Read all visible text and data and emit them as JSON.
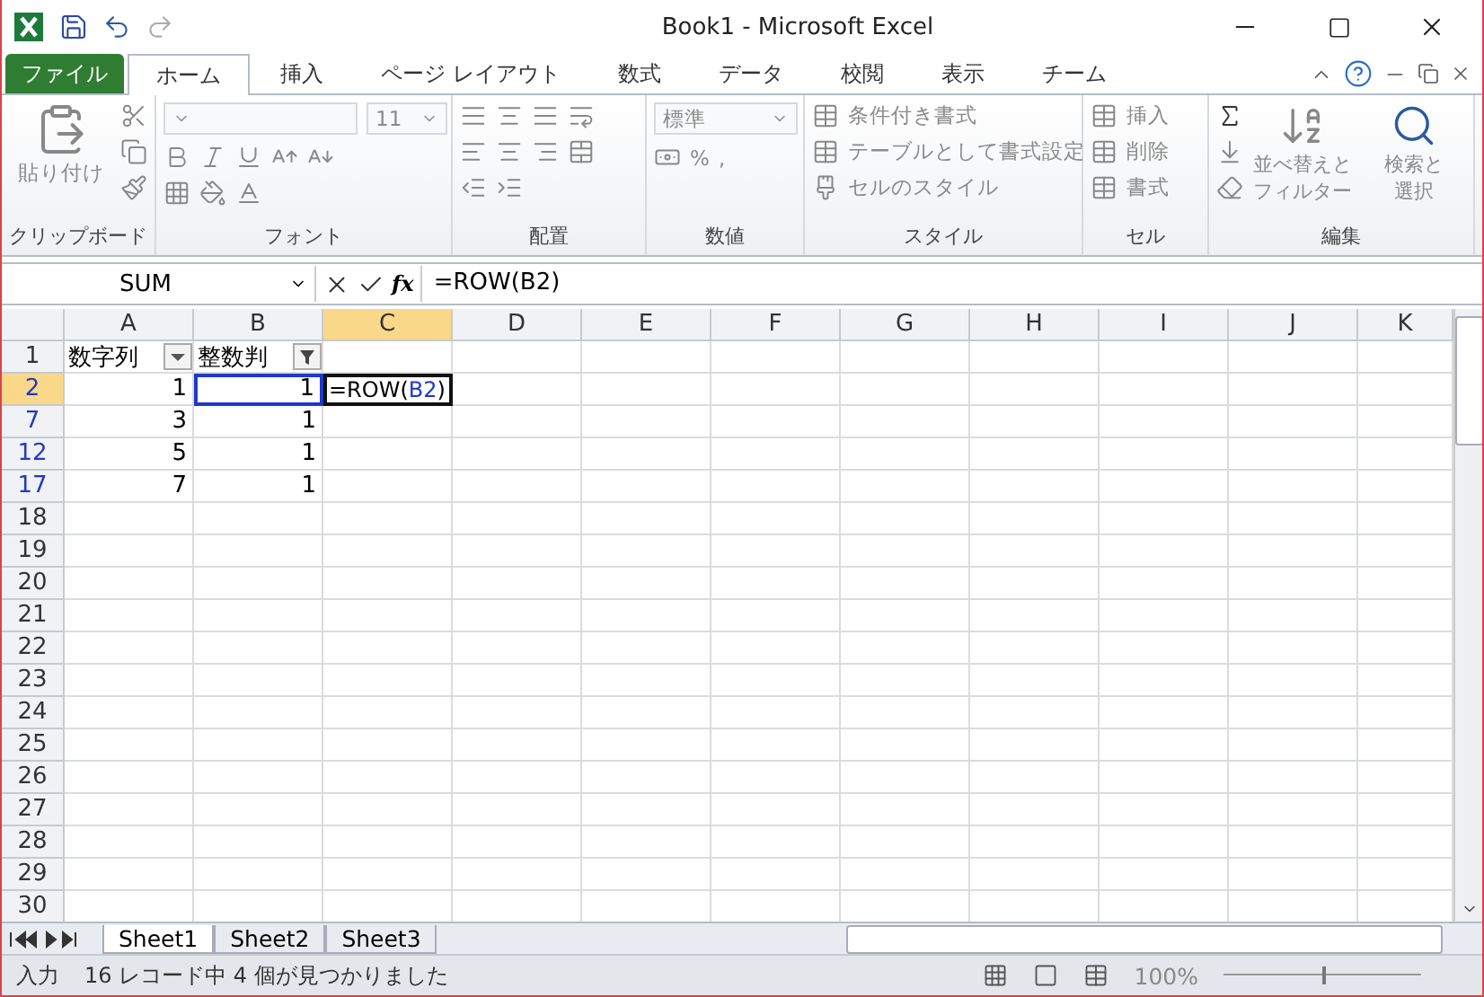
{
  "window": {
    "title": "Book1 - Microsoft Excel"
  },
  "ribbon_tabs": [
    {
      "label": "ファイル",
      "kind": "file",
      "selected": false
    },
    {
      "label": "ホーム",
      "kind": "tab",
      "selected": true
    },
    {
      "label": "挿入",
      "kind": "tab",
      "selected": false
    },
    {
      "label": "ページ レイアウト",
      "kind": "tab",
      "selected": false
    },
    {
      "label": "数式",
      "kind": "tab",
      "selected": false
    },
    {
      "label": "データ",
      "kind": "tab",
      "selected": false
    },
    {
      "label": "校閲",
      "kind": "tab",
      "selected": false
    },
    {
      "label": "表示",
      "kind": "tab",
      "selected": false
    },
    {
      "label": "チーム",
      "kind": "tab",
      "selected": false
    }
  ],
  "ribbon": {
    "disabled": true,
    "groups": [
      {
        "kind": "clipboard",
        "label": "クリップボード",
        "commands": [
          "貼り付け"
        ]
      },
      {
        "kind": "font",
        "label": "フォント",
        "commands": [
          "11"
        ]
      },
      {
        "kind": "alignment",
        "label": "配置"
      },
      {
        "kind": "number",
        "label": "数値",
        "commands": [
          "標準",
          "%",
          ","
        ]
      },
      {
        "kind": "styles",
        "label": "スタイル",
        "commands": [
          "条件付き書式",
          "テーブルとして書式設定",
          "セルのスタイル"
        ]
      },
      {
        "kind": "cells",
        "label": "セル",
        "commands": [
          "挿入",
          "削除",
          "書式"
        ]
      },
      {
        "kind": "editing",
        "label": "編集",
        "commands": [
          "並べ替えと",
          "フィルター",
          "検索と",
          "選択"
        ]
      }
    ]
  },
  "formula_bar": {
    "name_box": "SUM",
    "function_button": "fx",
    "formula": "=ROW(B2)"
  },
  "columns": [
    {
      "label": "A",
      "selected": false
    },
    {
      "label": "B",
      "selected": false
    },
    {
      "label": "C",
      "selected": true
    },
    {
      "label": "D",
      "selected": false
    },
    {
      "label": "E",
      "selected": false
    },
    {
      "label": "F",
      "selected": false
    },
    {
      "label": "G",
      "selected": false
    },
    {
      "label": "H",
      "selected": false
    },
    {
      "label": "I",
      "selected": false
    },
    {
      "label": "J",
      "selected": false
    },
    {
      "label": "K",
      "selected": false
    }
  ],
  "rows": [
    {
      "number": "1",
      "matched": false,
      "selected": false,
      "cells": [
        {
          "kind": "filter_header",
          "text": "数字列",
          "filter_active": false
        },
        {
          "kind": "filter_header",
          "text": "整数判",
          "filter_active": true
        }
      ]
    },
    {
      "number": "2",
      "matched": true,
      "selected": true,
      "cells": [
        {
          "kind": "number",
          "text": "1"
        },
        {
          "kind": "reference",
          "text": "1"
        },
        {
          "kind": "editing",
          "parts": [
            {
              "kind": "plain",
              "text": "=ROW("
            },
            {
              "kind": "ref",
              "text": "B2"
            },
            {
              "kind": "plain",
              "text": ")"
            }
          ]
        }
      ]
    },
    {
      "number": "7",
      "matched": true,
      "selected": false,
      "cells": [
        {
          "kind": "number",
          "text": "3"
        },
        {
          "kind": "number",
          "text": "1"
        }
      ]
    },
    {
      "number": "12",
      "matched": true,
      "selected": false,
      "cells": [
        {
          "kind": "number",
          "text": "5"
        },
        {
          "kind": "number",
          "text": "1"
        }
      ]
    },
    {
      "number": "17",
      "matched": true,
      "selected": false,
      "cells": [
        {
          "kind": "number",
          "text": "7"
        },
        {
          "kind": "number",
          "text": "1"
        }
      ]
    },
    {
      "number": "18",
      "matched": false,
      "selected": false,
      "cells": []
    },
    {
      "number": "19",
      "matched": false,
      "selected": false,
      "cells": []
    },
    {
      "number": "20",
      "matched": false,
      "selected": false,
      "cells": []
    },
    {
      "number": "21",
      "matched": false,
      "selected": false,
      "cells": []
    },
    {
      "number": "22",
      "matched": false,
      "selected": false,
      "cells": []
    },
    {
      "number": "23",
      "matched": false,
      "selected": false,
      "cells": []
    },
    {
      "number": "24",
      "matched": false,
      "selected": false,
      "cells": []
    },
    {
      "number": "25",
      "matched": false,
      "selected": false,
      "cells": []
    },
    {
      "number": "26",
      "matched": false,
      "selected": false,
      "cells": []
    },
    {
      "number": "27",
      "matched": false,
      "selected": false,
      "cells": []
    },
    {
      "number": "28",
      "matched": false,
      "selected": false,
      "cells": []
    },
    {
      "number": "29",
      "matched": false,
      "selected": false,
      "cells": []
    },
    {
      "number": "30",
      "matched": false,
      "selected": false,
      "cells": []
    }
  ],
  "sheet_tabs": [
    {
      "label": "Sheet1",
      "selected": true
    },
    {
      "label": "Sheet2",
      "selected": false
    },
    {
      "label": "Sheet3",
      "selected": false
    }
  ],
  "status_bar": {
    "mode": "入力",
    "message": "16 レコード中 4 個が見つかりました",
    "zoom": "100%",
    "zoom_slider": {
      "level": 0.5
    }
  }
}
